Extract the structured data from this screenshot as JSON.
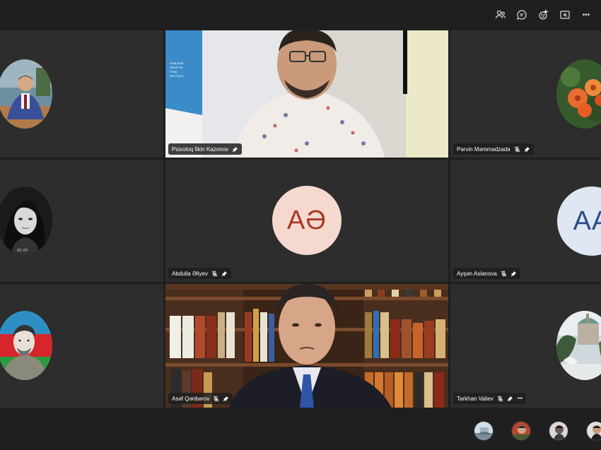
{
  "toolbar": {
    "icons": [
      "people-icon",
      "chat-icon",
      "reactions-icon",
      "share-icon",
      "more-icon"
    ],
    "more_label": "•••"
  },
  "participants": [
    {
      "name": "",
      "kind": "photo"
    },
    {
      "name": "Psixoloq İlkin Kazımov",
      "kind": "video",
      "pinned": true
    },
    {
      "name": "Pərvin Məmmədzadə",
      "kind": "photo",
      "muted": true,
      "pinned": true
    },
    {
      "name": "",
      "kind": "photo"
    },
    {
      "name": "Abdulla Əliyev",
      "kind": "initials",
      "initials": "AƏ",
      "avatar_color": "#f5d9cf",
      "initials_color": "#a63a28",
      "muted": true,
      "pinned": true
    },
    {
      "name": "Ayşən Aslanova",
      "kind": "initials",
      "initials": "AA",
      "avatar_color": "#dfe7f3",
      "initials_color": "#2a4a86",
      "muted": true,
      "pinned": true
    },
    {
      "name": "",
      "kind": "photo"
    },
    {
      "name": "Asəf Qənbərov",
      "kind": "video",
      "muted": true,
      "pinned": true
    },
    {
      "name": "Tarkhan Valiev",
      "kind": "photo",
      "muted": true,
      "pinned": true,
      "more": "•••"
    }
  ],
  "photo_overlay_text": "ƏZ ZƏ",
  "background_sign_text": "PUBLIKAR\nSƏHİYYƏ\nSTAN\nNSTITUTU",
  "colors": {
    "tile_bg": "#2d2d2d",
    "app_bg": "#1f1f1f"
  }
}
